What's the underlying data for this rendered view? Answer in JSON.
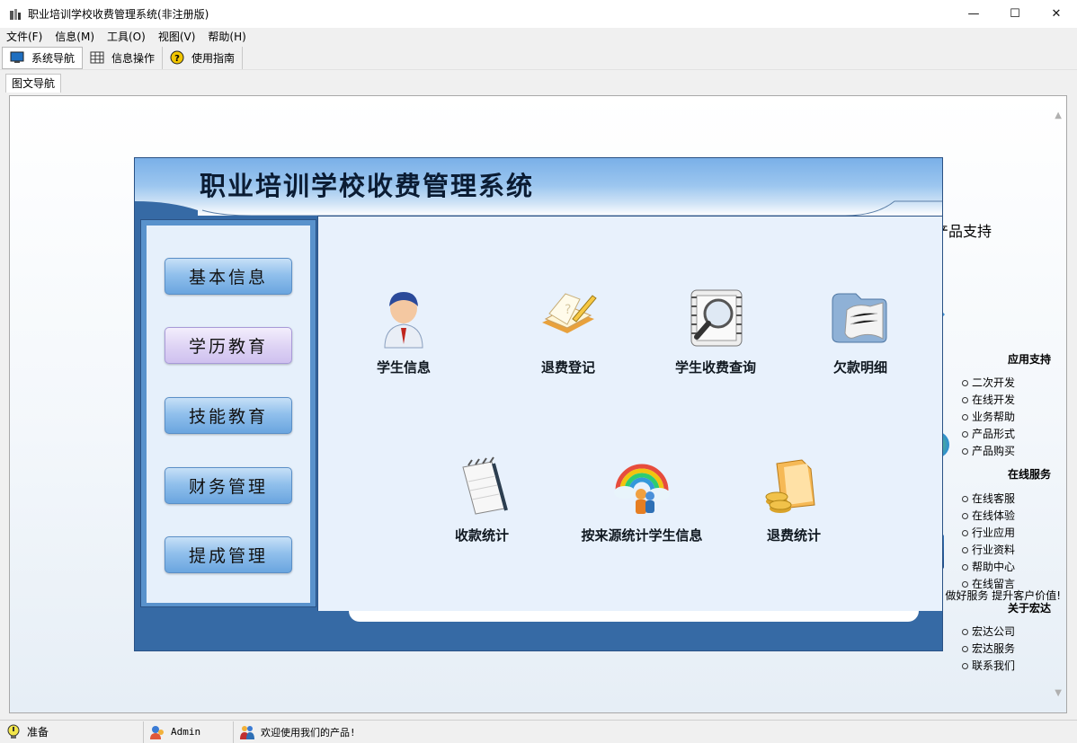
{
  "window": {
    "title": "职业培训学校收费管理系统(非注册版)",
    "minimize": "—",
    "maximize": "☐",
    "close": "✕"
  },
  "menu": [
    "文件(F)",
    "信息(M)",
    "工具(O)",
    "视图(V)",
    "帮助(H)"
  ],
  "toolbar": {
    "nav_label": "系统导航",
    "info_label": "信息操作",
    "guide_label": "使用指南"
  },
  "tab": {
    "label": "图文导航"
  },
  "modal": {
    "title": "职业培训学校收费管理系统",
    "nav": [
      "基本信息",
      "学历教育",
      "技能教育",
      "财务管理",
      "提成管理"
    ],
    "selected_nav": "学历教育",
    "tiles": [
      {
        "label": "学生信息",
        "icon": "student-icon"
      },
      {
        "label": "退费登记",
        "icon": "refund-register-icon"
      },
      {
        "label": "学生收费查询",
        "icon": "fee-query-icon"
      },
      {
        "label": "欠款明细",
        "icon": "arrears-detail-icon"
      },
      {
        "label": "收款统计",
        "icon": "receipt-stats-icon"
      },
      {
        "label": "按来源统计学生信息",
        "icon": "source-stats-icon"
      },
      {
        "label": "退费统计",
        "icon": "refund-stats-icon"
      }
    ]
  },
  "right_panel": {
    "title": "产品支持",
    "sections": [
      {
        "heading": "应用支持",
        "items": [
          "二次开发",
          "在线开发",
          "业务帮助",
          "产品形式",
          "产品购买"
        ]
      },
      {
        "heading": "在线服务",
        "items": [
          "在线客服",
          "在线体验",
          "行业应用",
          "行业资料",
          "帮助中心",
          "在线留言"
        ]
      },
      {
        "heading": "关于宏达",
        "items": [
          "宏达公司",
          "宏达服务",
          "联系我们"
        ]
      }
    ],
    "motto": "宏达理念:出好产品  做好服务  提升客户价值!"
  },
  "status": {
    "ready": "准备",
    "user": "Admin",
    "welcome": "欢迎使用我们的产品!"
  },
  "colors": {
    "modal_bg": "#366aa5",
    "header_blue": "#7ab0e8",
    "nav_button": "#91c0ec",
    "selected_button": "#ddd2f4"
  }
}
